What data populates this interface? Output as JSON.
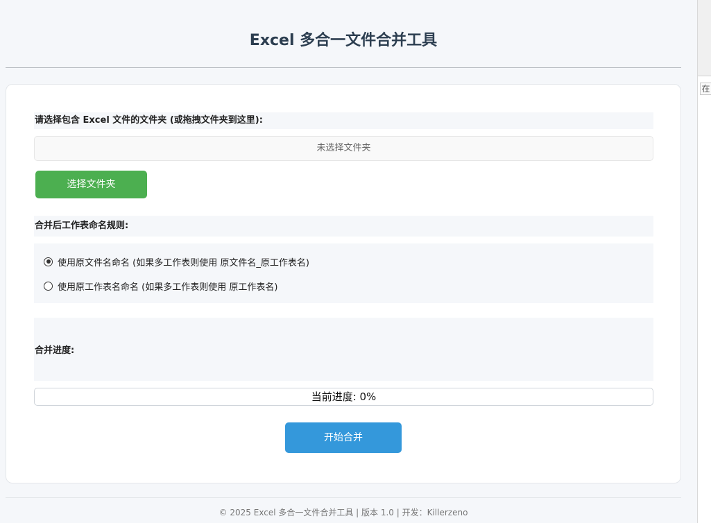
{
  "header": {
    "title": "Excel 多合一文件合并工具"
  },
  "folder_section": {
    "label": "请选择包含 Excel 文件的文件夹 (或拖拽文件夹到这里):",
    "display_text": "未选择文件夹",
    "select_button_label": "选择文件夹",
    "button_color": "#4caf50"
  },
  "naming_section": {
    "label": "合并后工作表命名规则:",
    "options": [
      {
        "label": "使用原文件名命名 (如果多工作表则使用 原文件名_原工作表名)",
        "checked": true
      },
      {
        "label": "使用原工作表名命名 (如果多工作表则使用 原工作表名)",
        "checked": false
      }
    ]
  },
  "progress_section": {
    "label": "合并进度:",
    "status_text": "当前进度: 0%",
    "percent": 0
  },
  "actions": {
    "start_button_label": "开始合并",
    "button_color": "#3498db"
  },
  "footer": {
    "text": "© 2025 Excel 多合一文件合并工具 | 版本 1.0 | 开发：Killerzeno"
  },
  "browser_side": {
    "tab_label": "在"
  }
}
